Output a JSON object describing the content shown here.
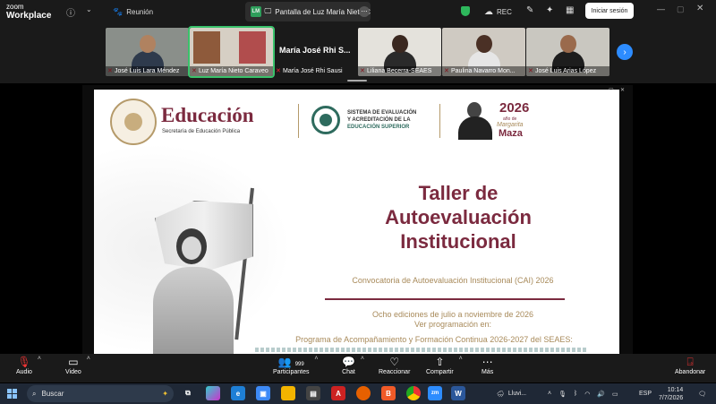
{
  "app": {
    "logo_line1": "zoom",
    "logo_line2": "Workplace",
    "meeting_label": "Reunión",
    "share_label": "Pantalla de Luz María Nieto C",
    "share_initials": "LM",
    "rec_label": "REC",
    "login_label": "Iniciar sesión"
  },
  "gallery": {
    "participants": [
      {
        "name": "José Luis Lara Méndez",
        "muted": true,
        "active": false
      },
      {
        "name": "Luz María Nieto Caraveo",
        "muted": true,
        "active": true
      },
      {
        "name": "María José Rhi Sausi",
        "muted": true,
        "active": false,
        "display_name": "María José Rhi S..."
      },
      {
        "name": "Liliana Becerra-SEAES",
        "muted": true,
        "active": false
      },
      {
        "name": "Paulina Navarro Mon...",
        "muted": true,
        "active": false
      },
      {
        "name": "José Luis Arias López",
        "muted": true,
        "active": false
      }
    ],
    "next_icon": "chevron-right-icon"
  },
  "slide": {
    "educacion": "Educación",
    "sep_subtitle": "Secretaría de Educación Pública",
    "seaes_line1": "SISTEMA DE EVALUACIÓN",
    "seaes_line2": "Y ACREDITACIÓN DE LA",
    "seaes_line3": "EDUCACIÓN SUPERIOR",
    "year": "2026",
    "year_sub": "año de",
    "margarita": "Margarita",
    "maza": "Maza",
    "title_line1": "Taller de",
    "title_line2": "Autoevaluación",
    "title_line3": "Institucional",
    "subtitle": "Convocatoria de Autoevaluación Institucional (CAI) 2026",
    "editions": "Ocho ediciones de julio a noviembre de 2026",
    "ver": "Ver programación en:",
    "program": "Programa de Acompañamiento y Formación Continua 2026-2027 del SEAES:",
    "colors": {
      "guinda": "#7b2a3f",
      "gold": "#a88a5a",
      "teal": "#2e6b5e"
    }
  },
  "toolbar": {
    "audio": "Audio",
    "video": "Video",
    "participants": "Participantes",
    "participant_count": "999",
    "chat": "Chat",
    "react": "Reaccionar",
    "share": "Compartir",
    "more": "Más",
    "leave": "Abandonar"
  },
  "taskbar": {
    "search_placeholder": "Buscar",
    "weather": "Lluvi...",
    "lang": "ESP",
    "time": "10:14",
    "date": "7/7/2026"
  }
}
